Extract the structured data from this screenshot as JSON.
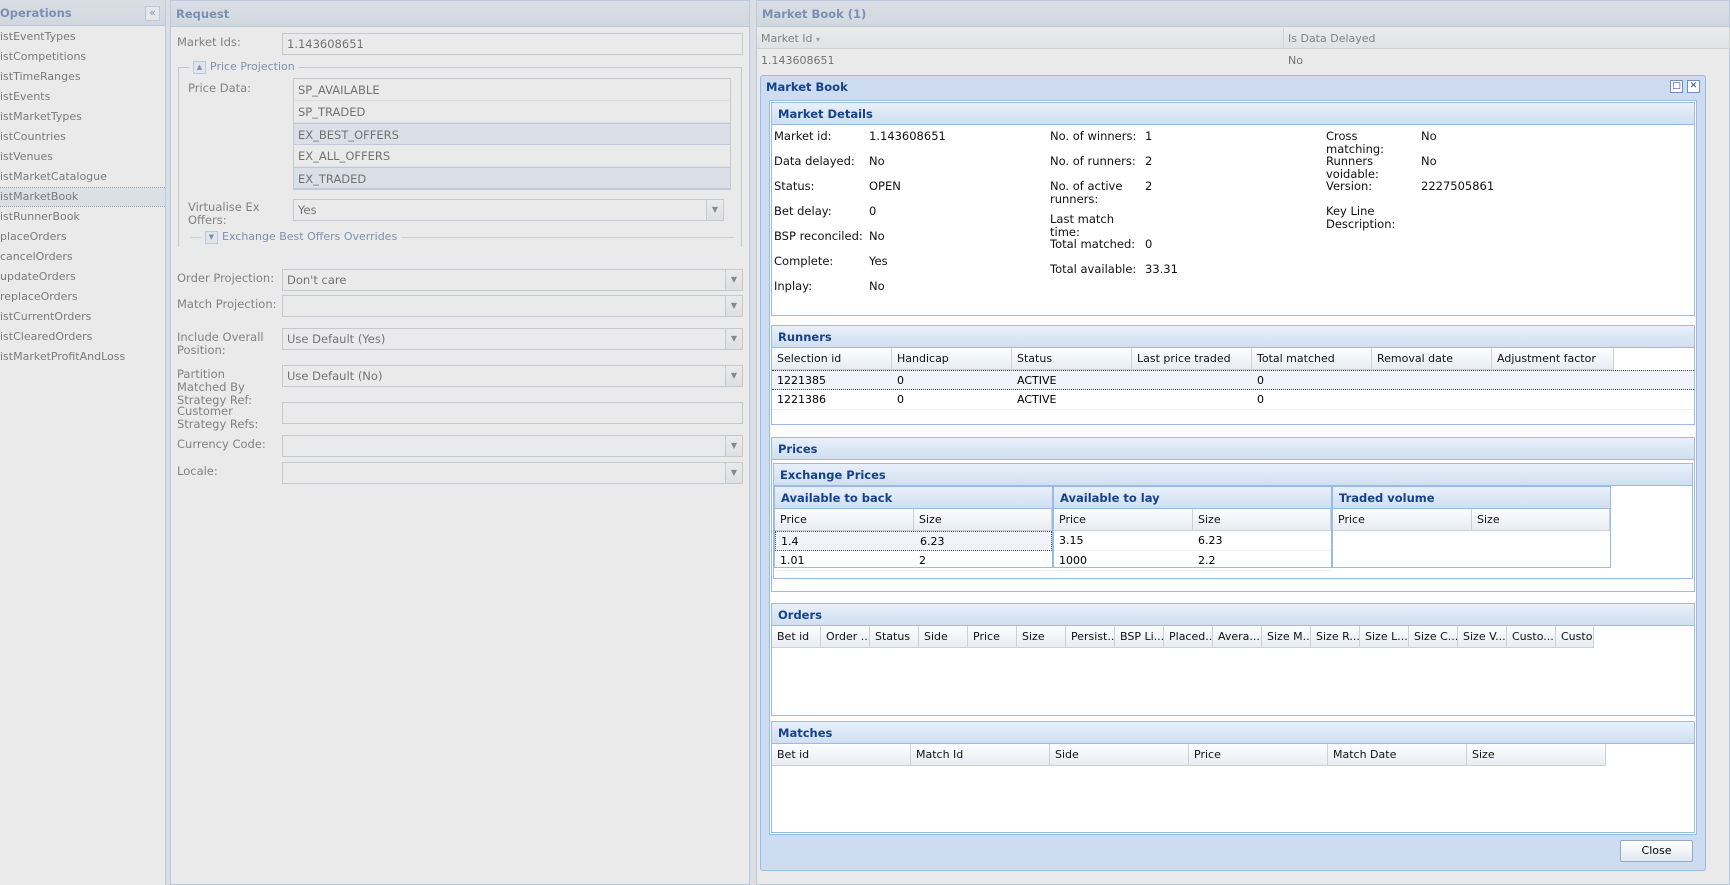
{
  "operations": {
    "title": "Operations",
    "collapse_glyph": "«",
    "items": [
      "istEventTypes",
      "istCompetitions",
      "istTimeRanges",
      "istEvents",
      "istMarketTypes",
      "istCountries",
      "istVenues",
      "istMarketCatalogue",
      "istMarketBook",
      "istRunnerBook",
      "placeOrders",
      "cancelOrders",
      "updateOrders",
      "replaceOrders",
      "istCurrentOrders",
      "istClearedOrders",
      "istMarketProfitAndLoss"
    ],
    "selected": "istMarketBook"
  },
  "request": {
    "title": "Request",
    "market_ids_label": "Market Ids:",
    "market_ids_value": "1.143608651",
    "price_projection_legend": "Price Projection",
    "price_data_label": "Price Data:",
    "price_data_options": [
      "SP_AVAILABLE",
      "SP_TRADED",
      "EX_BEST_OFFERS",
      "EX_ALL_OFFERS",
      "EX_TRADED"
    ],
    "price_data_selected": [
      "EX_BEST_OFFERS",
      "EX_TRADED"
    ],
    "virtualise_label": "Virtualise Ex Offers:",
    "virtualise_value": "Yes",
    "ebo_overrides_legend": "Exchange Best Offers Overrides",
    "order_projection_label": "Order Projection:",
    "order_projection_value": "Don't care",
    "match_projection_label": "Match Projection:",
    "match_projection_value": "",
    "include_overall_label": "Include Overall Position:",
    "include_overall_value": "Use Default (Yes)",
    "partition_label": "Partition Matched By Strategy Ref:",
    "partition_value": "Use Default (No)",
    "customer_strategy_label": "Customer Strategy Refs:",
    "customer_strategy_value": "",
    "currency_label": "Currency Code:",
    "currency_value": "",
    "locale_label": "Locale:",
    "locale_value": ""
  },
  "market_book_list": {
    "title": "Market Book (1)",
    "columns": [
      "Market Id",
      "Is Data Delayed"
    ],
    "sort_glyph": "▾",
    "rows": [
      [
        "1.143608651",
        "No"
      ]
    ]
  },
  "dialog": {
    "title": "Market Book",
    "maximize_glyph": "□",
    "close_glyph": "✕",
    "close_button": "Close",
    "market_details": {
      "title": "Market Details",
      "col1": [
        {
          "label": "Market id:",
          "value": "1.143608651"
        },
        {
          "label": "Data delayed:",
          "value": "No"
        },
        {
          "label": "Status:",
          "value": "OPEN"
        },
        {
          "label": "Bet delay:",
          "value": "0"
        },
        {
          "label": "BSP reconciled:",
          "value": "No"
        },
        {
          "label": "Complete:",
          "value": "Yes"
        },
        {
          "label": "Inplay:",
          "value": "No"
        }
      ],
      "col2": [
        {
          "label": "No. of winners:",
          "value": "1"
        },
        {
          "label": "No. of runners:",
          "value": "2"
        },
        {
          "label": "No. of active runners:",
          "value": "2"
        },
        {
          "label": "Last match time:",
          "value": ""
        },
        {
          "label": "Total matched:",
          "value": "0"
        },
        {
          "label": "Total available:",
          "value": "33.31"
        }
      ],
      "col3": [
        {
          "label": "Cross matching:",
          "value": "No"
        },
        {
          "label": "Runners voidable:",
          "value": "No"
        },
        {
          "label": "Version:",
          "value": "2227505861"
        },
        {
          "label": "Key Line Description:",
          "value": ""
        }
      ]
    },
    "runners": {
      "title": "Runners",
      "columns": [
        "Selection id",
        "Handicap",
        "Status",
        "Last price traded",
        "Total matched",
        "Removal date",
        "Adjustment factor"
      ],
      "rows": [
        [
          "1221385",
          "0",
          "ACTIVE",
          "",
          "0",
          "",
          ""
        ],
        [
          "1221386",
          "0",
          "ACTIVE",
          "",
          "0",
          "",
          ""
        ]
      ]
    },
    "prices": {
      "title": "Prices",
      "exchange_title": "Exchange Prices",
      "back": {
        "title": "Available to back",
        "columns": [
          "Price",
          "Size"
        ],
        "rows": [
          [
            "1.4",
            "6.23"
          ],
          [
            "1.01",
            "2"
          ]
        ]
      },
      "lay": {
        "title": "Available to lay",
        "columns": [
          "Price",
          "Size"
        ],
        "rows": [
          [
            "3.15",
            "6.23"
          ],
          [
            "1000",
            "2.2"
          ]
        ]
      },
      "traded": {
        "title": "Traded volume",
        "columns": [
          "Price",
          "Size"
        ],
        "rows": []
      }
    },
    "orders": {
      "title": "Orders",
      "columns": [
        "Bet id",
        "Order ...",
        "Status",
        "Side",
        "Price",
        "Size",
        "Persist...",
        "BSP Li...",
        "Placed...",
        "Avera...",
        "Size M...",
        "Size R...",
        "Size L...",
        "Size C...",
        "Size V...",
        "Custo...",
        "Custo..."
      ]
    },
    "matches": {
      "title": "Matches",
      "columns": [
        "Bet id",
        "Match Id",
        "Side",
        "Price",
        "Match Date",
        "Size"
      ]
    }
  }
}
